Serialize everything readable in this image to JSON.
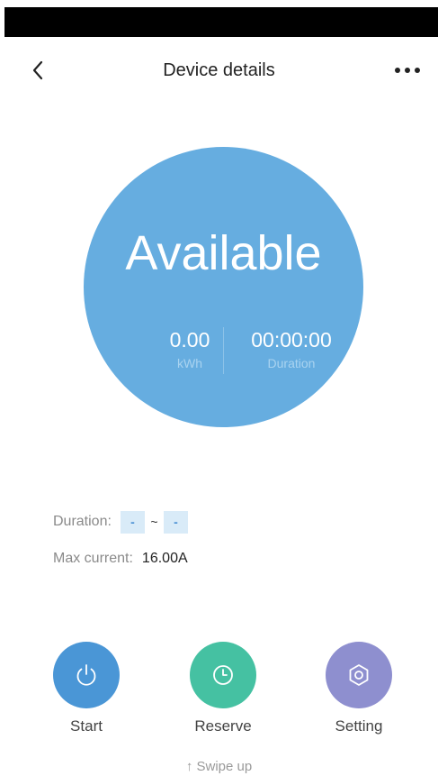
{
  "header": {
    "title": "Device details",
    "back_icon": "chevron-left-icon",
    "more_icon": "more-horizontal-icon"
  },
  "status": {
    "label": "Available",
    "energy_value": "0.00",
    "energy_unit": "kWh",
    "duration_value": "00:00:00",
    "duration_label": "Duration",
    "circle_color": "#66ade0"
  },
  "info": {
    "duration_label": "Duration:",
    "duration_start": "-",
    "duration_separator": "~",
    "duration_end": "-",
    "max_current_label": "Max current:",
    "max_current_value": "16.00A"
  },
  "actions": [
    {
      "label": "Start",
      "icon": "power-icon",
      "color": "#4a96d6"
    },
    {
      "label": "Reserve",
      "icon": "clock-icon",
      "color": "#45c1a2"
    },
    {
      "label": "Setting",
      "icon": "gear-icon",
      "color": "#8e8fcf"
    }
  ],
  "footer": {
    "swipe_hint": "↑ Swipe up"
  }
}
